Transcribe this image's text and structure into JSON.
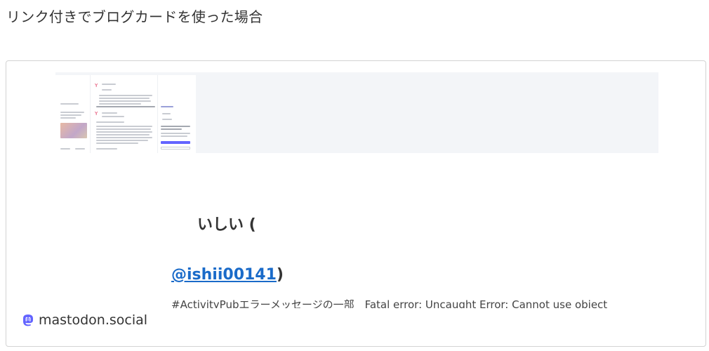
{
  "heading": "リンク付きでブログカードを使った場合",
  "card": {
    "title": "いしい (",
    "handle": "@ishii00141",
    "handle_suffix": ")",
    "description": "#ActivityPubエラーメッセージの一部　Fatal error: Uncaught Error: Cannot use object",
    "site_name": "mastodon.social",
    "site_icon": "mastodon-icon",
    "colors": {
      "link": "#1a6bc9",
      "thumb_bg": "#f3f5f8",
      "mastodon": "#6364ff"
    }
  }
}
